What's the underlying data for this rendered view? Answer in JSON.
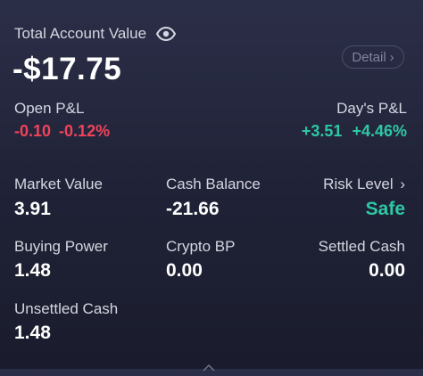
{
  "header": {
    "title": "Total Account Value",
    "eye_icon": "eye-icon",
    "total_value": "-$17.75",
    "detail_label": "Detail",
    "detail_chevron": "›"
  },
  "open_pl": {
    "label": "Open P&L",
    "amount": "-0.10",
    "percent": "-0.12%",
    "color": "#f0435a"
  },
  "days_pl": {
    "label": "Day's P&L",
    "amount": "+3.51",
    "percent": "+4.46%",
    "color": "#2ec7a4"
  },
  "stats": {
    "market_value": {
      "label": "Market Value",
      "value": "3.91"
    },
    "cash_balance": {
      "label": "Cash Balance",
      "value": "-21.66"
    },
    "risk_level": {
      "label": "Risk Level",
      "chevron": "›",
      "value": "Safe",
      "color": "#2ec7a4"
    },
    "buying_power": {
      "label": "Buying Power",
      "value": "1.48"
    },
    "crypto_bp": {
      "label": "Crypto BP",
      "value": "0.00"
    },
    "settled_cash": {
      "label": "Settled Cash",
      "value": "0.00"
    },
    "unsettled_cash": {
      "label": "Unsettled Cash",
      "value": "1.48"
    }
  }
}
